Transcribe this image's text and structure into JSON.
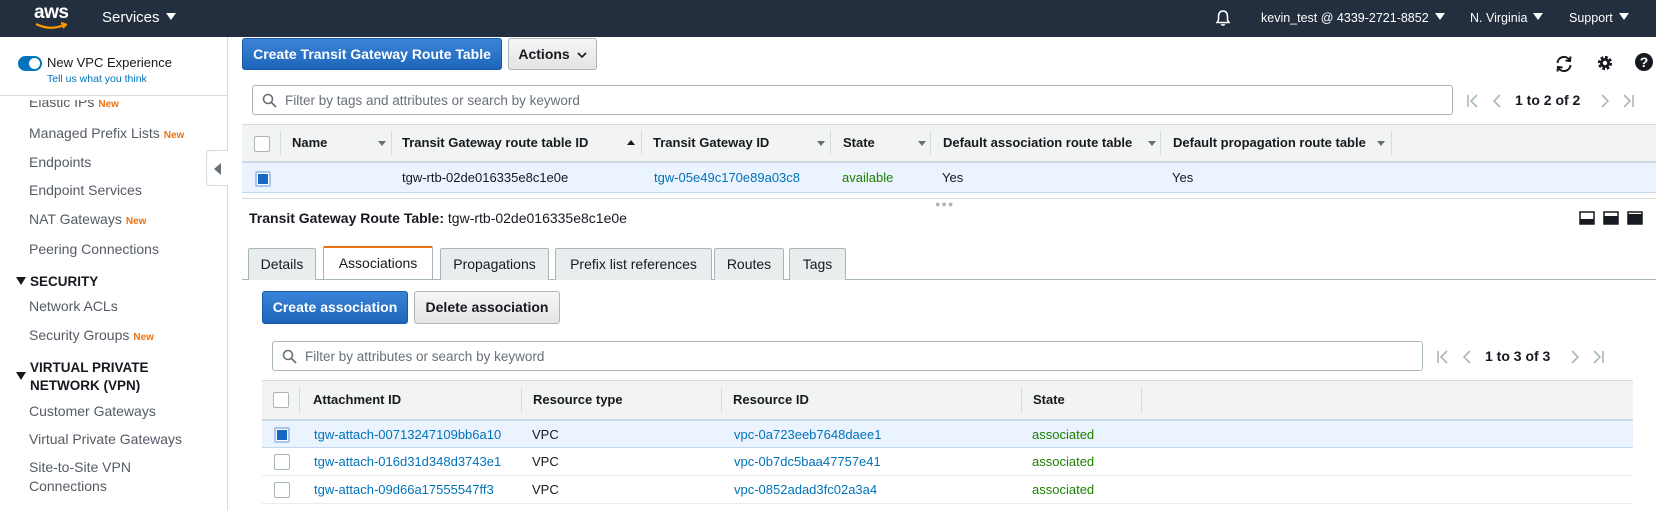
{
  "topnav": {
    "logo_text": "aws",
    "services_label": "Services",
    "account_label": "kevin_test @ 4339-2721-8852",
    "region_label": "N. Virginia",
    "support_label": "Support"
  },
  "sidebar": {
    "new_vpc_experience": "New VPC Experience",
    "tell_us": "Tell us what you think",
    "items": [
      {
        "label": "Elastic IPs",
        "badge": "New"
      },
      {
        "label": "Managed Prefix Lists",
        "badge": "New"
      },
      {
        "label": "Endpoints",
        "badge": ""
      },
      {
        "label": "Endpoint Services",
        "badge": ""
      },
      {
        "label": "NAT Gateways",
        "badge": "New"
      },
      {
        "label": "Peering Connections",
        "badge": ""
      }
    ],
    "security_heading": "SECURITY",
    "security_items": [
      {
        "label": "Network ACLs",
        "badge": ""
      },
      {
        "label": "Security Groups",
        "badge": "New"
      }
    ],
    "vpn_heading_line1": "VIRTUAL PRIVATE",
    "vpn_heading_line2": "NETWORK (VPN)",
    "vpn_items": [
      {
        "label": "Customer Gateways"
      },
      {
        "label": "Virtual Private Gateways"
      },
      {
        "label": "Site-to-Site VPN"
      },
      {
        "label": "Connections"
      }
    ]
  },
  "toolbar": {
    "create_label": "Create Transit Gateway Route Table",
    "actions_label": "Actions"
  },
  "top_table": {
    "filter_placeholder": "Filter by tags and attributes or search by keyword",
    "pager_text": "1 to 2 of 2",
    "columns": [
      "Name",
      "Transit Gateway route table ID",
      "Transit Gateway ID",
      "State",
      "Default association route table",
      "Default propagation route table"
    ],
    "rows": [
      {
        "name": "",
        "route_table_id": "tgw-rtb-02de016335e8c1e0e",
        "tgw_id": "tgw-05e49c170e89a03c8",
        "state": "available",
        "default_assoc": "Yes",
        "default_prop": "Yes"
      }
    ]
  },
  "detail": {
    "title_label": "Transit Gateway Route Table:",
    "title_value": "tgw-rtb-02de016335e8c1e0e",
    "tabs": [
      "Details",
      "Associations",
      "Propagations",
      "Prefix list references",
      "Routes",
      "Tags"
    ],
    "active_tab": "Associations",
    "create_assoc_label": "Create association",
    "delete_assoc_label": "Delete association",
    "filter_placeholder": "Filter by attributes or search by keyword",
    "pager_text": "1 to 3 of 3",
    "columns": [
      "Attachment ID",
      "Resource type",
      "Resource ID",
      "State"
    ],
    "rows": [
      {
        "attachment_id": "tgw-attach-00713247109bb6a10",
        "resource_type": "VPC",
        "resource_id": "vpc-0a723eeb7648daee1",
        "state": "associated",
        "selected": true
      },
      {
        "attachment_id": "tgw-attach-016d31d348d3743e1",
        "resource_type": "VPC",
        "resource_id": "vpc-0b7dc5baa47757e41",
        "state": "associated",
        "selected": false
      },
      {
        "attachment_id": "tgw-attach-09d66a17555547ff3",
        "resource_type": "VPC",
        "resource_id": "vpc-0852adad3fc02a3a4",
        "state": "associated",
        "selected": false
      }
    ]
  },
  "colors": {
    "nav_bg": "#232f3e",
    "primary": "#2e73c6",
    "link": "#0073bb",
    "success": "#1d8102",
    "new_badge": "#ec7211",
    "active_tab": "#ec7211"
  }
}
